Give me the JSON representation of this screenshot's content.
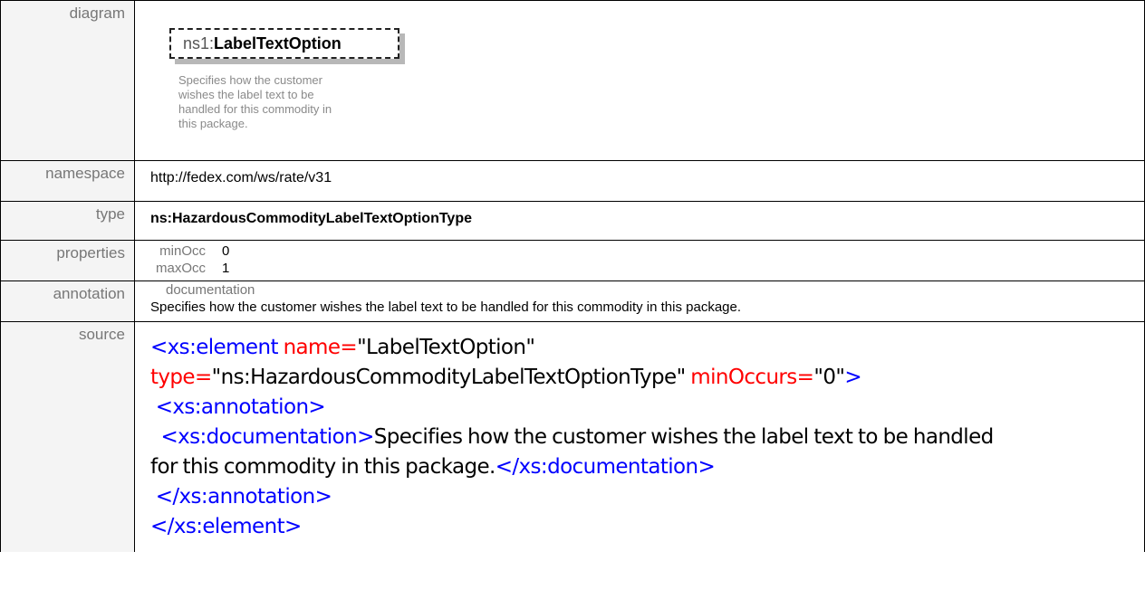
{
  "rows": {
    "diagram": {
      "label": "diagram",
      "prefix": "ns1:",
      "name": "LabelTextOption",
      "doc": "Specifies how the customer wishes the label text to be handled for this commodity in this package."
    },
    "namespace": {
      "label": "namespace",
      "value": "http://fedex.com/ws/rate/v31"
    },
    "type": {
      "label": "type",
      "value": "ns:HazardousCommodityLabelTextOptionType"
    },
    "properties": {
      "label": "properties",
      "min_key": "minOcc",
      "min_val": "0",
      "max_key": "maxOcc",
      "max_val": "1"
    },
    "annotation": {
      "label": "annotation",
      "key": "documentation",
      "value": "Specifies how the customer wishes the label text to be handled for this commodity  in this package."
    },
    "source": {
      "label": "source",
      "l1_tag": "<xs:element",
      "l1_attr1": "name=",
      "l1_val1": "\"LabelTextOption\"",
      "l2_attr2": "type=",
      "l2_val2": "\"ns:HazardousCommodityLabelTextOptionType\"",
      "l2_attr3": "minOccurs=",
      "l2_val3": "\"0\"",
      "l2_close": ">",
      "l3_tag": "<xs:annotation>",
      "l4_tag_open": "<xs:documentation",
      "l4_gt": ">",
      "l4_text": "Specifies how the customer wishes the label text to be handled",
      "l5_text": "for this commodity in this package.",
      "l5_tag_close": "</xs:documentation",
      "l5_gt": ">",
      "l6_tag": "</xs:annotation>",
      "l7_tag": "</xs:element>"
    }
  }
}
